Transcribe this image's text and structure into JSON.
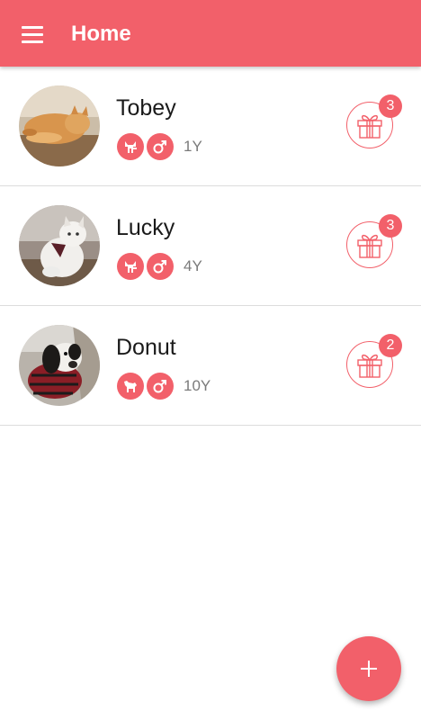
{
  "header": {
    "title": "Home",
    "menu_icon": "hamburger-menu-icon",
    "color": "#f2606a"
  },
  "pets": [
    {
      "name": "Tobey",
      "species_icon": "cat-icon",
      "gender_icon": "male-icon",
      "age": "1Y",
      "gift_count": "3",
      "photo": "orange cat photo"
    },
    {
      "name": "Lucky",
      "species_icon": "cat-icon",
      "gender_icon": "male-icon",
      "age": "4Y",
      "gift_count": "3",
      "photo": "white cat photo"
    },
    {
      "name": "Donut",
      "species_icon": "dog-icon",
      "gender_icon": "male-icon",
      "age": "10Y",
      "gift_count": "2",
      "photo": "spaniel dog photo"
    }
  ],
  "fab": {
    "icon": "plus-icon"
  }
}
